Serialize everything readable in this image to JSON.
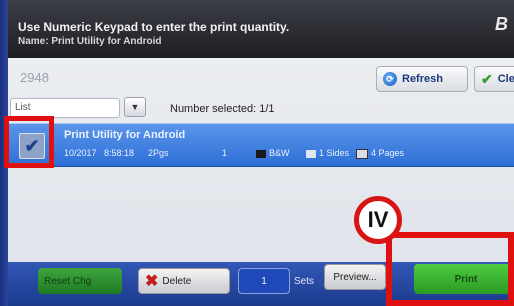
{
  "header": {
    "message": "Use Numeric Keypad to enter the print quantity.",
    "subtitle": "Name: Print Utility for Android",
    "corner_glyph": "B"
  },
  "job": {
    "id": "2948"
  },
  "toolbar": {
    "refresh_label": "Refresh",
    "refresh_icon": "refresh-icon",
    "clear_label": "Clear",
    "clear_icon": "check-icon"
  },
  "list": {
    "view_value": "List",
    "number_selected": "Number selected: 1/1"
  },
  "jobs": [
    {
      "title": "Print Utility for Android",
      "date": "10/2017",
      "time": "8:58:18",
      "pages_short": "2Pgs",
      "copies": "1",
      "color_mode": "B&W",
      "sides": "1 Sides",
      "pages": "4 Pages",
      "selected": true
    }
  ],
  "annotation": {
    "badge": "IV",
    "color": "#e01010"
  },
  "footer": {
    "release_label": "Reset Chg",
    "delete_label": "Delete",
    "quantity": "1",
    "sets_label": "Sets",
    "preview_label": "Preview...",
    "print_label": "Print"
  },
  "colors": {
    "selection_blue": "#2d6fd6",
    "footer_blue": "#1b3a8c",
    "print_green": "#2b9a25"
  }
}
